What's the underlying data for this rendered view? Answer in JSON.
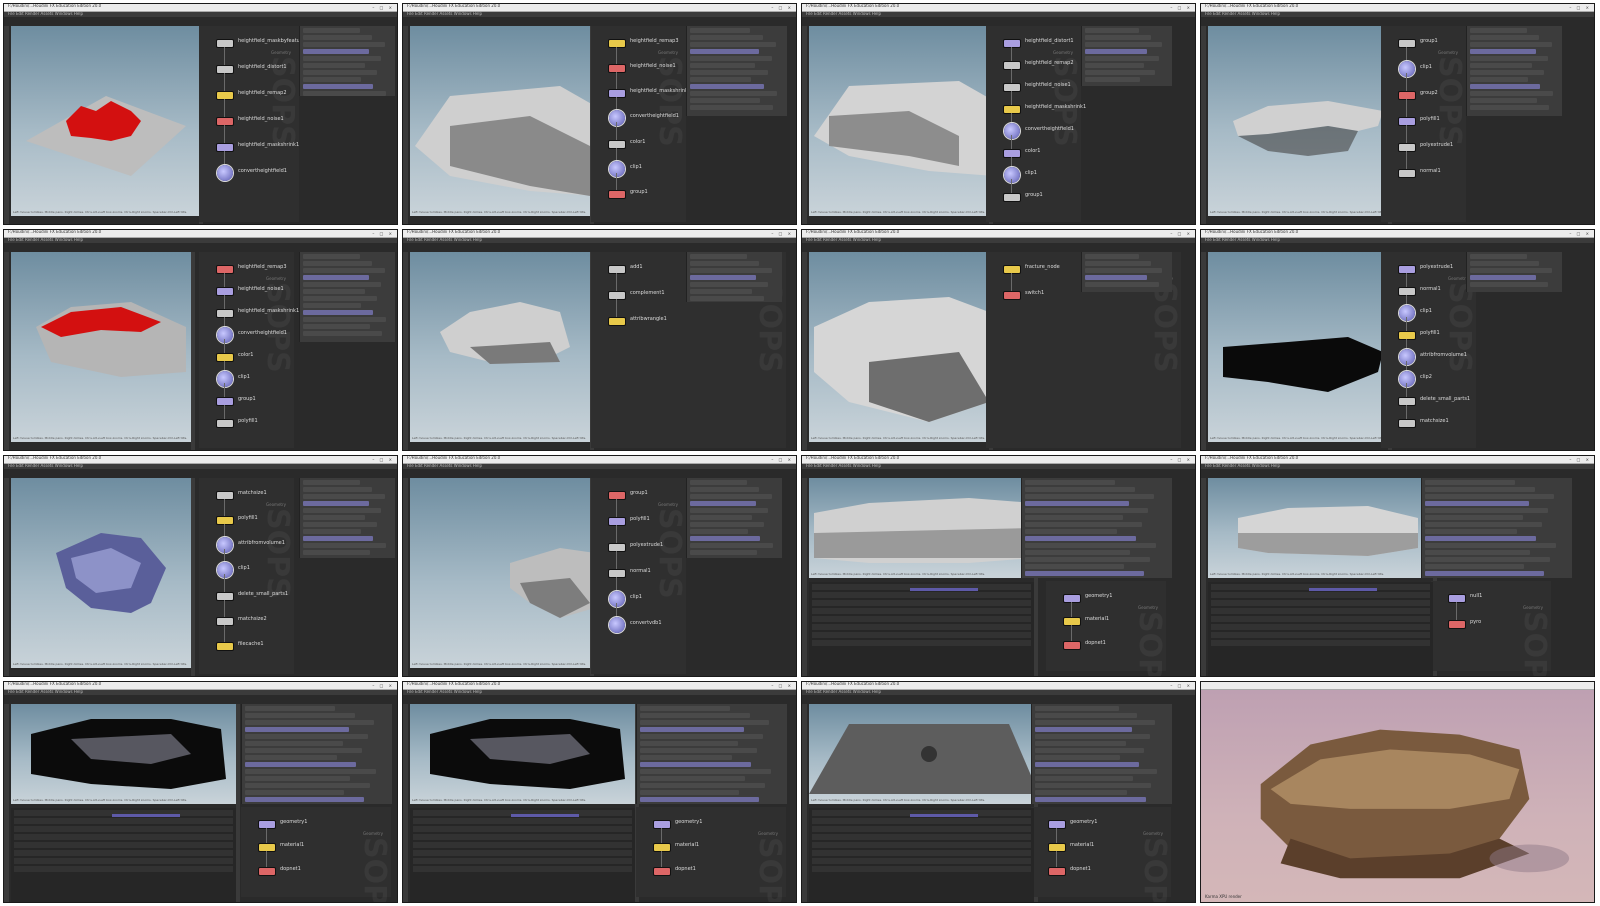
{
  "window_title": "F:/Houdini/...Houdini FX Education Edition 20.0",
  "menu_text": "File Edit Render Assets Windows Help",
  "path_label": "Geometry",
  "watermark_text": "SOPS",
  "panels": [
    {
      "nodes": [
        "heightfield_maskbyfeature1",
        "heightfield_distort1",
        "heightfield_remap2",
        "heightfield_noise1",
        "heightfield_maskshrink1",
        "convertheightfield1"
      ]
    },
    {
      "nodes": [
        "heightfield_remap3",
        "heightfield_noise1",
        "heightfield_maskshrink1",
        "convertheightfield1",
        "color1",
        "clip1",
        "group1"
      ]
    },
    {
      "nodes": [
        "heightfield_distort1",
        "heightfield_remap2",
        "heightfield_noise1",
        "heightfield_maskshrink1",
        "convertheightfield1",
        "color1",
        "clip1",
        "group1"
      ]
    },
    {
      "nodes": [
        "group1",
        "clip1",
        "group2",
        "polyfill1",
        "polyextrude1",
        "normal1"
      ]
    },
    {
      "nodes": [
        "heightfield_remap3",
        "heightfield_noise1",
        "heightfield_maskshrink1",
        "convertheightfield1",
        "color1",
        "clip1",
        "group1",
        "polyfill1"
      ]
    },
    {
      "nodes": [
        "add1",
        "complement1",
        "attribwrangle1"
      ]
    },
    {
      "nodes": [
        "fracture_node",
        "switch1"
      ]
    },
    {
      "nodes": [
        "polyextrude1",
        "normal1",
        "clip1",
        "polyfill1",
        "attribfromvolume1",
        "clip2",
        "delete_small_parts1",
        "matchsize1"
      ]
    },
    {
      "nodes": [
        "matchsize1",
        "polyfill1",
        "attribfromvolume1",
        "clip1",
        "delete_small_parts1",
        "matchsize2",
        "filecache1"
      ]
    },
    {
      "nodes": [
        "group1",
        "polyfill1",
        "polyextrude1",
        "normal1",
        "clip1",
        "convertvdb1"
      ]
    },
    {
      "nodes": [
        "geometry1",
        "material1",
        "dopnet1"
      ]
    },
    {
      "nodes": [
        "null1",
        "pyro"
      ]
    },
    {
      "nodes": [
        "geometry1",
        "material1",
        "dopnet1"
      ]
    },
    {
      "nodes": [
        "geometry1",
        "material1",
        "dopnet1"
      ]
    },
    {
      "nodes": [
        "geometry1",
        "material1",
        "dopnet1"
      ]
    },
    {
      "nodes": []
    }
  ],
  "vp_status": "Left mouse tumbles. Middle pans. Right dollies. Ctrl+Alt+Left box-zooms. Ctrl+Right zooms. Spacebar-Ctrl-Left tilts.",
  "render_footer": "Karma XPU render"
}
